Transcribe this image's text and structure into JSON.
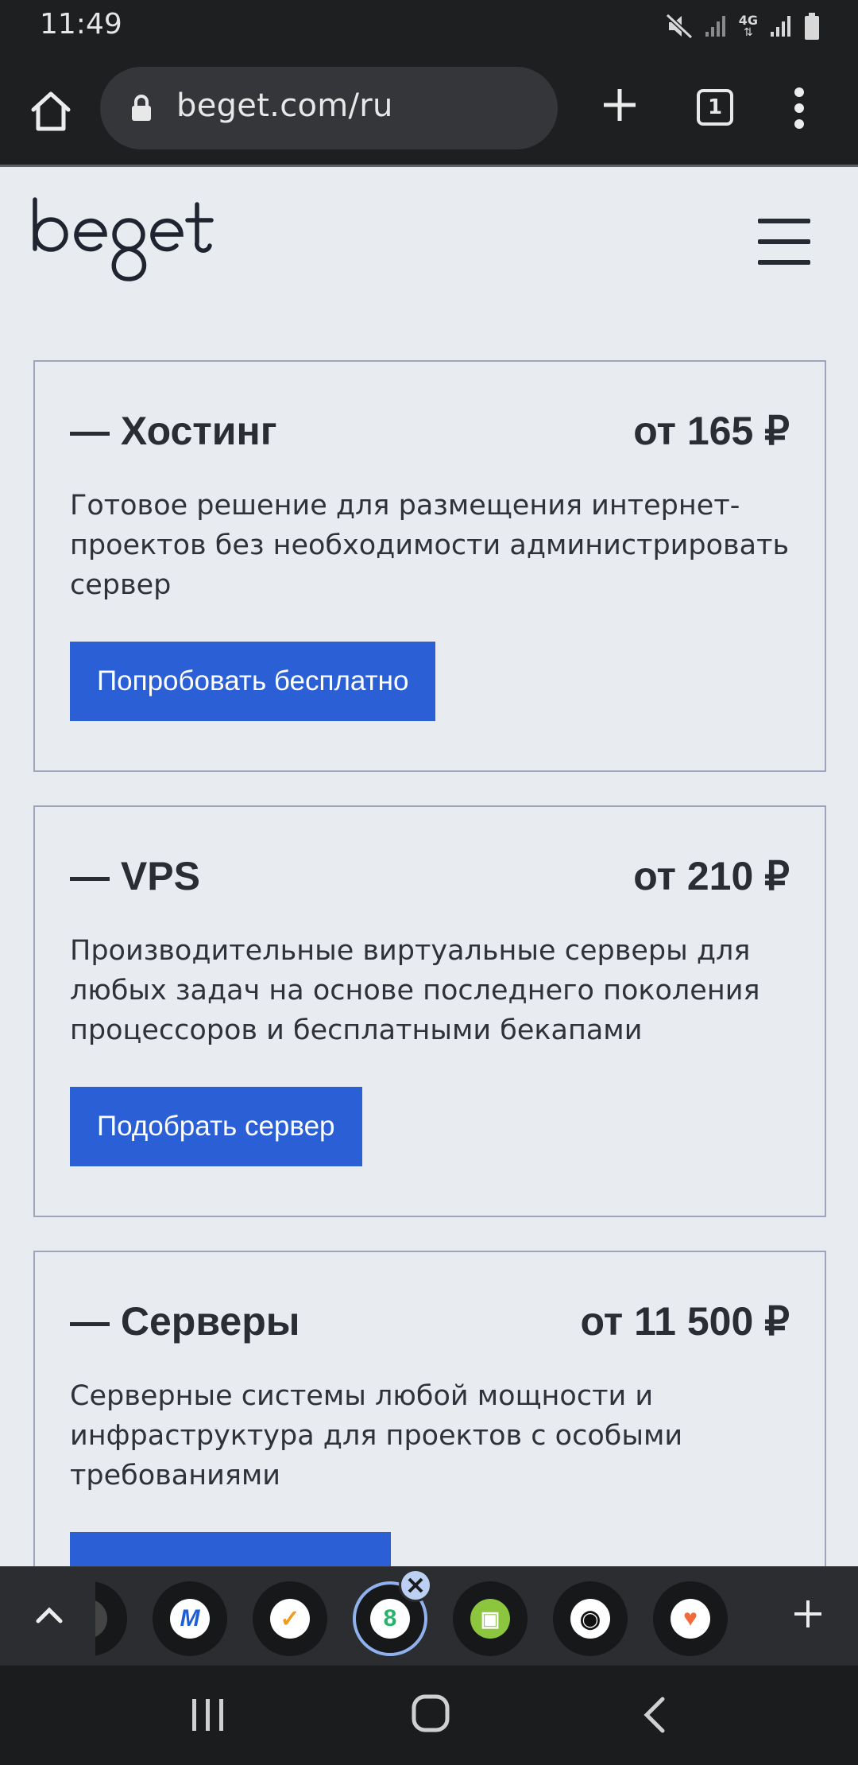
{
  "status_bar": {
    "time": "11:49",
    "network_label": "4G",
    "icons": [
      "mute-icon",
      "signal-icon",
      "signal-icon",
      "battery-icon"
    ]
  },
  "browser": {
    "url": "beget.com/ru",
    "tab_count": "1",
    "icons": [
      "home-icon",
      "lock-icon",
      "new-tab-icon",
      "tabs-icon",
      "more-icon"
    ]
  },
  "site": {
    "logo_text": "beget"
  },
  "cards": [
    {
      "title": "— Хостинг",
      "price": "от 165 ₽",
      "description": "Готовое решение для размещения интернет-проектов без необходимости администрировать сервер",
      "button": "Попробовать бесплатно"
    },
    {
      "title": "— VPS",
      "price": "от 210 ₽",
      "description": "Производительные виртуальные серверы для любых задач на основе последнего поколения процессоров и бесплатными бекапами",
      "button": "Подобрать сервер"
    },
    {
      "title": "— Серверы",
      "price": "от 11 500 ₽",
      "description": "Серверные системы любой мощности и инфраструктура для проектов с особыми требованиями",
      "button": ""
    }
  ],
  "dock": {
    "tabs": [
      {
        "name": "tab-partial",
        "glyph": "",
        "color": "#555555"
      },
      {
        "name": "tab-m",
        "glyph": "M",
        "color": "#1f5fd6"
      },
      {
        "name": "tab-checkmark",
        "glyph": "✓",
        "color": "#f29a1a"
      },
      {
        "name": "tab-beget",
        "glyph": "8",
        "color": "#27b46a"
      },
      {
        "name": "tab-screen",
        "glyph": "▣",
        "color": "#8cc63f"
      },
      {
        "name": "tab-globe",
        "glyph": "◉",
        "color": "#111111"
      },
      {
        "name": "tab-heart",
        "glyph": "♥",
        "color": "#f06a3a"
      }
    ]
  },
  "nav": {
    "icons": [
      "recents-icon",
      "home-button-icon",
      "back-icon"
    ]
  }
}
